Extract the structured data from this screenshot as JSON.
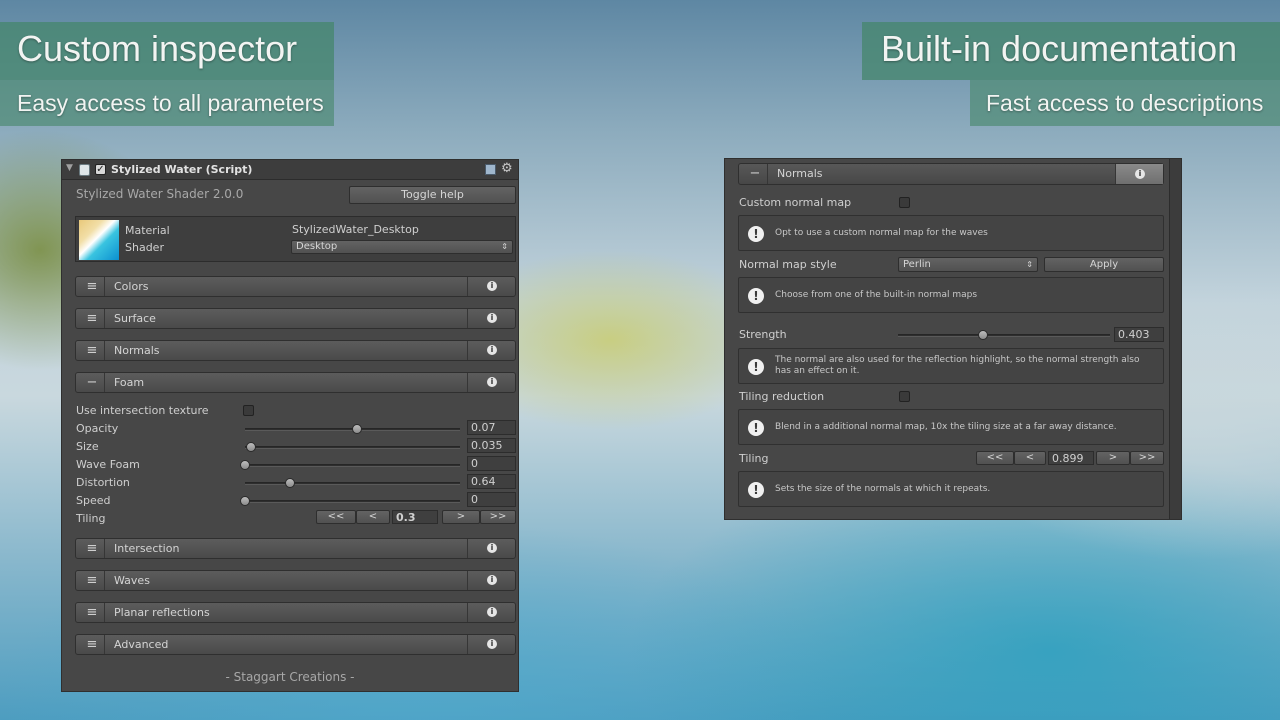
{
  "banners": {
    "left_title": "Custom inspector",
    "left_subtitle": "Easy access to all parameters",
    "right_title": "Built-in documentation",
    "right_subtitle": "Fast access to descriptions"
  },
  "inspector": {
    "header_title": "Stylized Water (Script)",
    "version": "Stylized Water Shader 2.0.0",
    "toggle_help": "Toggle help",
    "material_label": "Material",
    "material_value": "StylizedWater_Desktop",
    "shader_label": "Shader",
    "shader_value": "Desktop",
    "sections_top": [
      "Colors",
      "Surface",
      "Normals"
    ],
    "foam_section": "Foam",
    "foam": {
      "use_intersection_label": "Use intersection texture",
      "opacity_label": "Opacity",
      "opacity_value": "0.07",
      "opacity_level": 0.52,
      "size_label": "Size",
      "size_value": "0.035",
      "size_level": 0.03,
      "wavefoam_label": "Wave Foam",
      "wavefoam_value": "0",
      "wavefoam_level": 0.0,
      "distortion_label": "Distortion",
      "distortion_value": "0.64",
      "distortion_level": 0.21,
      "speed_label": "Speed",
      "speed_value": "0",
      "speed_level": 0.0,
      "tiling_label": "Tiling",
      "tiling_value": "0.3",
      "btn_first": "<<",
      "btn_prev": "<",
      "btn_next": ">",
      "btn_last": ">>"
    },
    "sections_bottom": [
      "Intersection",
      "Waves",
      "Planar reflections",
      "Advanced"
    ],
    "footer": "- Staggart Creations -"
  },
  "docs": {
    "section_title": "Normals",
    "custom_normal_map_label": "Custom normal map",
    "help_custom": "Opt to use a custom normal map for the waves",
    "normal_style_label": "Normal map style",
    "normal_style_value": "Perlin",
    "apply_label": "Apply",
    "help_style": "Choose from one of the built-in normal maps",
    "strength_label": "Strength",
    "strength_value": "0.403",
    "strength_level": 0.4,
    "help_strength": "The normal are also used for the reflection highlight, so the normal strength also has an effect on it.",
    "tiling_reduction_label": "Tiling reduction",
    "help_tiling_reduction": "Blend in a additional normal map, 10x the tiling size at a far away distance.",
    "tiling_label": "Tiling",
    "tiling_value": "0.899",
    "btn_first": "<<",
    "btn_prev": "<",
    "btn_next": ">",
    "btn_last": ">>",
    "help_tiling": "Sets the size of the normals at which it repeats."
  },
  "icons": {
    "component": "script-component-icon",
    "enable": "checkbox-icon",
    "reference": "book-icon",
    "settings": "gear-icon",
    "info": "info-icon",
    "warning": "exclamation-icon"
  }
}
